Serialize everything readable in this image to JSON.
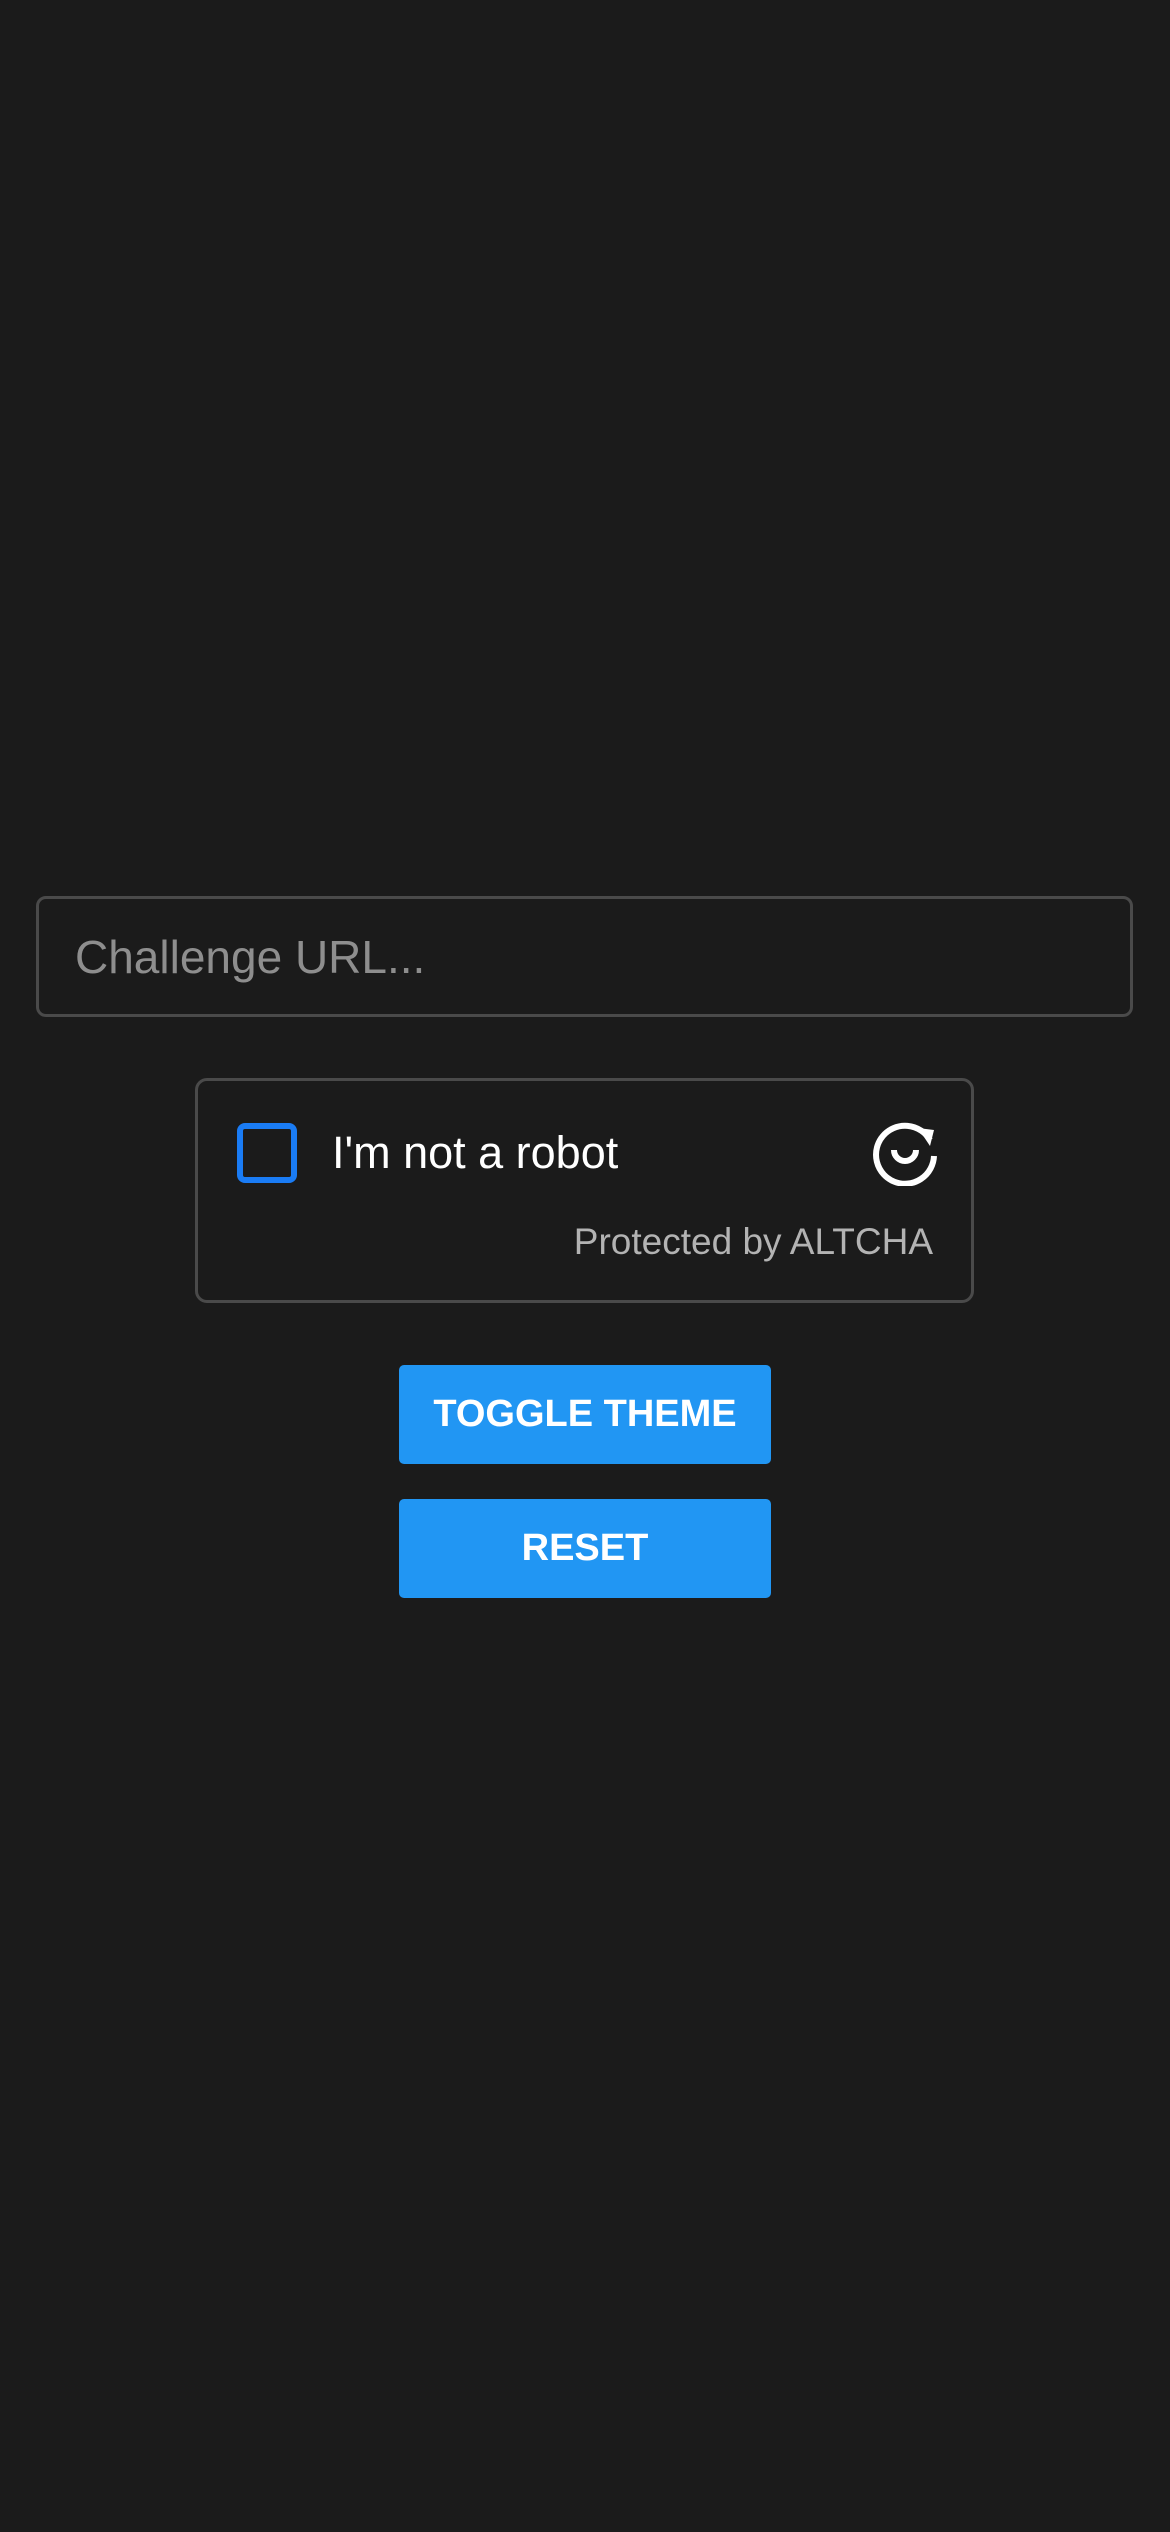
{
  "challenge_input": {
    "placeholder": "Challenge URL...",
    "value": ""
  },
  "widget": {
    "checkbox_label": "I'm not a robot",
    "checked": false,
    "footer": "Protected by ALTCHA",
    "logo_icon": "altcha-logo-icon",
    "accent_color": "#1a7cf5"
  },
  "buttons": {
    "toggle_theme": "TOGGLE THEME",
    "reset": "RESET",
    "color": "#2196f3"
  }
}
